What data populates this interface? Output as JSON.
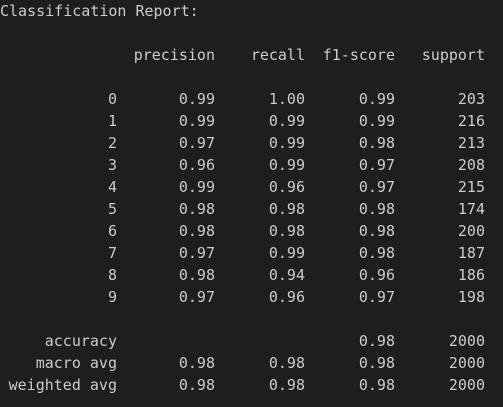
{
  "report": {
    "title": "Classification Report:",
    "headers": {
      "precision": "precision",
      "recall": "recall",
      "f1": "f1-score",
      "support": "support"
    },
    "class_rows": [
      {
        "label": "0",
        "precision": "0.99",
        "recall": "1.00",
        "f1": "0.99",
        "support": "203"
      },
      {
        "label": "1",
        "precision": "0.99",
        "recall": "0.99",
        "f1": "0.99",
        "support": "216"
      },
      {
        "label": "2",
        "precision": "0.97",
        "recall": "0.99",
        "f1": "0.98",
        "support": "213"
      },
      {
        "label": "3",
        "precision": "0.96",
        "recall": "0.99",
        "f1": "0.97",
        "support": "208"
      },
      {
        "label": "4",
        "precision": "0.99",
        "recall": "0.96",
        "f1": "0.97",
        "support": "215"
      },
      {
        "label": "5",
        "precision": "0.98",
        "recall": "0.98",
        "f1": "0.98",
        "support": "174"
      },
      {
        "label": "6",
        "precision": "0.98",
        "recall": "0.98",
        "f1": "0.98",
        "support": "200"
      },
      {
        "label": "7",
        "precision": "0.97",
        "recall": "0.99",
        "f1": "0.98",
        "support": "187"
      },
      {
        "label": "8",
        "precision": "0.98",
        "recall": "0.94",
        "f1": "0.96",
        "support": "186"
      },
      {
        "label": "9",
        "precision": "0.97",
        "recall": "0.96",
        "f1": "0.97",
        "support": "198"
      }
    ],
    "summary_rows": [
      {
        "label": "accuracy",
        "precision": "",
        "recall": "",
        "f1": "0.98",
        "support": "2000"
      },
      {
        "label": "macro avg",
        "precision": "0.98",
        "recall": "0.98",
        "f1": "0.98",
        "support": "2000"
      },
      {
        "label": "weighted avg",
        "precision": "0.98",
        "recall": "0.98",
        "f1": "0.98",
        "support": "2000"
      }
    ]
  },
  "colors": {
    "background": "#1e1e1e",
    "text": "#cccccc"
  }
}
